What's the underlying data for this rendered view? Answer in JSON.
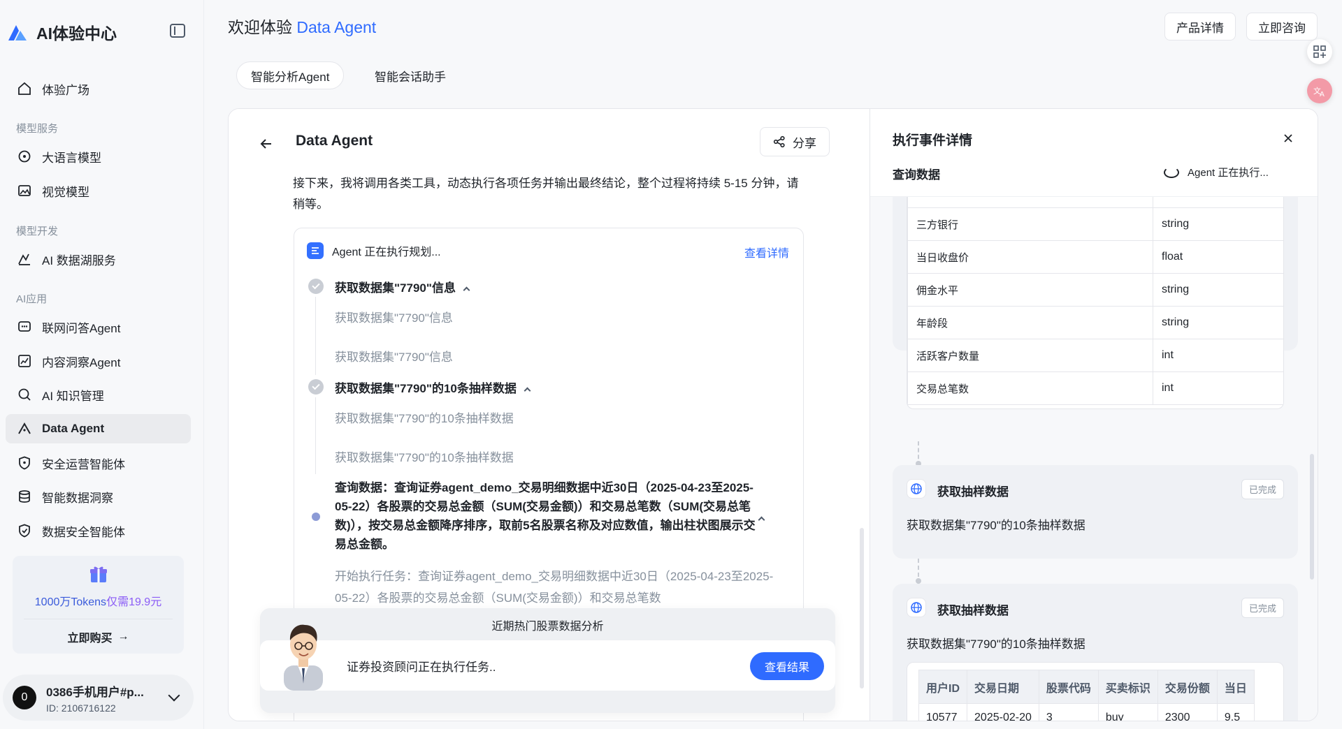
{
  "sidebar": {
    "brand": "AI体验中心",
    "items": [
      {
        "label": "体验广场",
        "icon": "home-icon"
      },
      {
        "label": "大语言模型",
        "icon": "model-icon"
      },
      {
        "label": "视觉模型",
        "icon": "image-icon"
      },
      {
        "label": "AI 数据湖服务",
        "icon": "datalake-icon"
      },
      {
        "label": "联网问答Agent",
        "icon": "chat-icon"
      },
      {
        "label": "内容洞察Agent",
        "icon": "insight-icon"
      },
      {
        "label": "AI 知识管理",
        "icon": "search-icon"
      },
      {
        "label": "Data Agent",
        "icon": "data-agent-icon"
      },
      {
        "label": "安全运营智能体",
        "icon": "shield-icon"
      },
      {
        "label": "智能数据洞察",
        "icon": "database-icon"
      },
      {
        "label": "数据安全智能体",
        "icon": "shield-check-icon"
      }
    ],
    "groups": [
      "模型服务",
      "模型开发",
      "AI应用"
    ],
    "promo": {
      "prefix": "1000万Tokens",
      "highlight": "仅需19.9元",
      "buy": "立即购买"
    },
    "user": {
      "avatar": "0",
      "name": "0386手机用户#p...",
      "id": "ID: 2106716122"
    }
  },
  "header": {
    "welcome_prefix": "欢迎体验",
    "welcome_accent": "Data Agent",
    "product_details": "产品详情",
    "consult": "立即咨询"
  },
  "tabs": [
    "智能分析Agent",
    "智能会话助手"
  ],
  "agent": {
    "title": "Data Agent",
    "share": "分享",
    "intro": "接下来，我将调用各类工具，动态执行各项任务并输出最终结论，整个过程将持续 5-15 分钟，请稍等。",
    "plan_status": "Agent 正在执行规划...",
    "view_details": "查看详情",
    "steps": [
      {
        "title": "获取数据集\"7790\"信息",
        "sub1": "获取数据集\"7790\"信息",
        "sub2": "获取数据集\"7790\"信息"
      },
      {
        "title": "获取数据集\"7790\"的10条抽样数据",
        "sub1": "获取数据集\"7790\"的10条抽样数据",
        "sub2": "获取数据集\"7790\"的10条抽样数据"
      }
    ],
    "query_step": "查询数据：查询证券agent_demo_交易明细数据中近30日（2025-04-23至2025-05-22）各股票的交易总金额（SUM(交易金额)）和交易总笔数（SUM(交易总笔数)），按交易总金额降序排序，取前5名股票名称及对应数值，输出柱状图展示交易总金额。",
    "query_sub": "开始执行任务：查询证券agent_demo_交易明细数据中近30日（2025-04-23至2025-05-22）各股票的交易总金额（SUM(交易金额)）和交易总笔数",
    "task": {
      "title": "近期热门股票数据分析",
      "text": "证券投资顾问正在执行任务..",
      "button": "查看结果"
    }
  },
  "detail_panel": {
    "title": "执行事件详情",
    "subtitle": "查询数据",
    "status": "Agent 正在执行...",
    "schema_rows": [
      {
        "name": "三方银行",
        "type": "string"
      },
      {
        "name": "当日收盘价",
        "type": "float"
      },
      {
        "name": "佣金水平",
        "type": "string"
      },
      {
        "name": "年龄段",
        "type": "string"
      },
      {
        "name": "活跃客户数量",
        "type": "int"
      },
      {
        "name": "交易总笔数",
        "type": "int"
      }
    ],
    "events": [
      {
        "title": "获取抽样数据",
        "badge": "已完成",
        "desc": "获取数据集\"7790\"的10条抽样数据"
      },
      {
        "title": "获取抽样数据",
        "badge": "已完成",
        "desc": "获取数据集\"7790\"的10条抽样数据"
      }
    ],
    "sample_headers": [
      "用户ID",
      "交易日期",
      "股票代码",
      "买卖标识",
      "交易份额",
      "当日"
    ],
    "sample_row": [
      "10577",
      "2025-02-20",
      "3",
      "buy",
      "2300",
      "9.5"
    ]
  },
  "colors": {
    "accent": "#2f6bff",
    "brand_purple": "#8b5cf6"
  }
}
